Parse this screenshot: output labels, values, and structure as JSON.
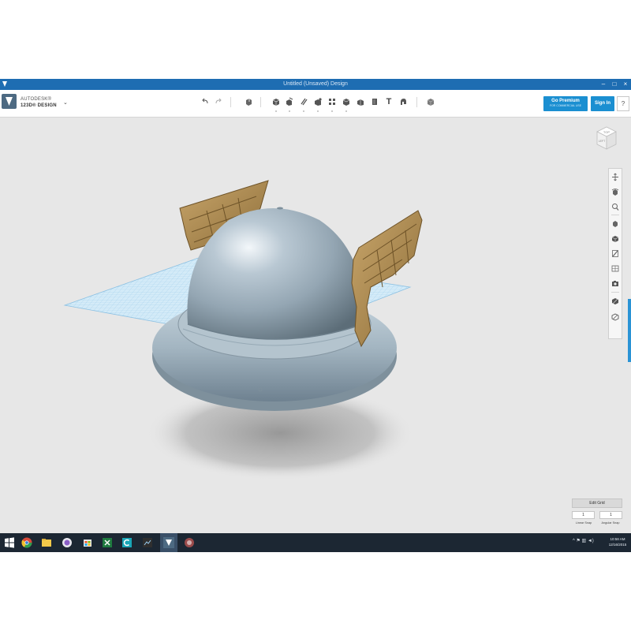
{
  "window": {
    "title": "Untitled (Unsaved) Design",
    "controls": [
      "–",
      "□",
      "×"
    ]
  },
  "app": {
    "brand_top": "AUTODESK®",
    "brand_bottom": "123D® DESIGN",
    "menu_caret": "⌄"
  },
  "toolbar": {
    "tools": [
      "undo-icon",
      "redo-icon",
      "transform-icon",
      "primitives-icon",
      "sketch-icon",
      "construct-icon",
      "modify-icon",
      "pattern-icon",
      "grouping-icon",
      "combine-icon",
      "measure-icon",
      "text-icon",
      "snap-icon",
      "material-icon"
    ],
    "text_tool_label": "T",
    "premium_label": "Go Premium",
    "premium_sub": "FOR COMMERCIAL USE",
    "signin_label": "Sign In",
    "help_label": "?"
  },
  "viewcube": {
    "face_label": "TOP",
    "side_label": "LEFT"
  },
  "navbar": {
    "tools": [
      "pan-icon",
      "orbit-icon",
      "zoom-icon",
      "fit-icon",
      "view-mode-icon",
      "material-display-icon",
      "grid-toggle-icon",
      "screenshot-icon",
      "shaded-icon",
      "outline-icon"
    ]
  },
  "grid_editor": {
    "button_label": "Edit Grid",
    "linear_snap_value": "1",
    "angular_snap_value": "1",
    "linear_snap_label": "Linear Snap",
    "angular_snap_label": "Angular Snap"
  },
  "scene": {
    "model": "winged-helmet",
    "colors": {
      "background": "#e7e7e7",
      "grid": "#a9d3ef",
      "grid_fill": "#cfe8f7",
      "helmet": "#a7b7c3",
      "helmet_shadow": "#6f7f8a",
      "wings": "#b0915a",
      "wings_dark": "#7b6131"
    }
  },
  "taskbar": {
    "apps": [
      "windows-start-icon",
      "chrome-icon",
      "file-explorer-icon",
      "pinned-app-icon",
      "store-icon",
      "excel-icon",
      "pinned-c-icon",
      "photos-icon",
      "123d-design-icon",
      "pinned-round-icon"
    ],
    "tray_text": "^ ⚑ ▥ ◄)",
    "time": "10:58 AM",
    "date": "12/16/2015"
  },
  "accent": "#1b8fd1"
}
